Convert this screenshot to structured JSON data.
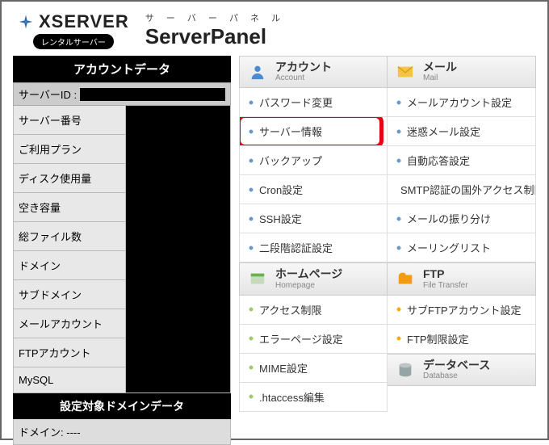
{
  "header": {
    "logo_text": "XSERVER",
    "logo_sub": "レンタルサーバー",
    "panel_kana": "サ ー バ ー パ ネ ル",
    "panel_title": "ServerPanel"
  },
  "sidebar": {
    "header1": "アカウントデータ",
    "server_id_label": "サーバーID :",
    "rows": [
      "サーバー番号",
      "ご利用プラン",
      "ディスク使用量",
      "空き容量",
      "総ファイル数",
      "ドメイン",
      "サブドメイン",
      "メールアカウント",
      "FTPアカウント",
      "MySQL"
    ],
    "header2": "設定対象ドメインデータ",
    "domain_label": "ドメイン:",
    "domain_value": "----"
  },
  "sections": {
    "account": {
      "jp": "アカウント",
      "en": "Account",
      "items": [
        "パスワード変更",
        "サーバー情報",
        "バックアップ",
        "Cron設定",
        "SSH設定",
        "二段階認証設定"
      ]
    },
    "homepage": {
      "jp": "ホームページ",
      "en": "Homepage",
      "items": [
        "アクセス制限",
        "エラーページ設定",
        "MIME設定",
        ".htaccess編集"
      ]
    },
    "mail": {
      "jp": "メール",
      "en": "Mail",
      "items": [
        "メールアカウント設定",
        "迷惑メール設定",
        "自動応答設定",
        "SMTP認証の国外アクセス制限",
        "メールの振り分け",
        "メーリングリスト"
      ]
    },
    "ftp": {
      "jp": "FTP",
      "en": "File Transfer",
      "items": [
        "サブFTPアカウント設定",
        "FTP制限設定"
      ]
    },
    "database": {
      "jp": "データベース",
      "en": "Database"
    }
  }
}
